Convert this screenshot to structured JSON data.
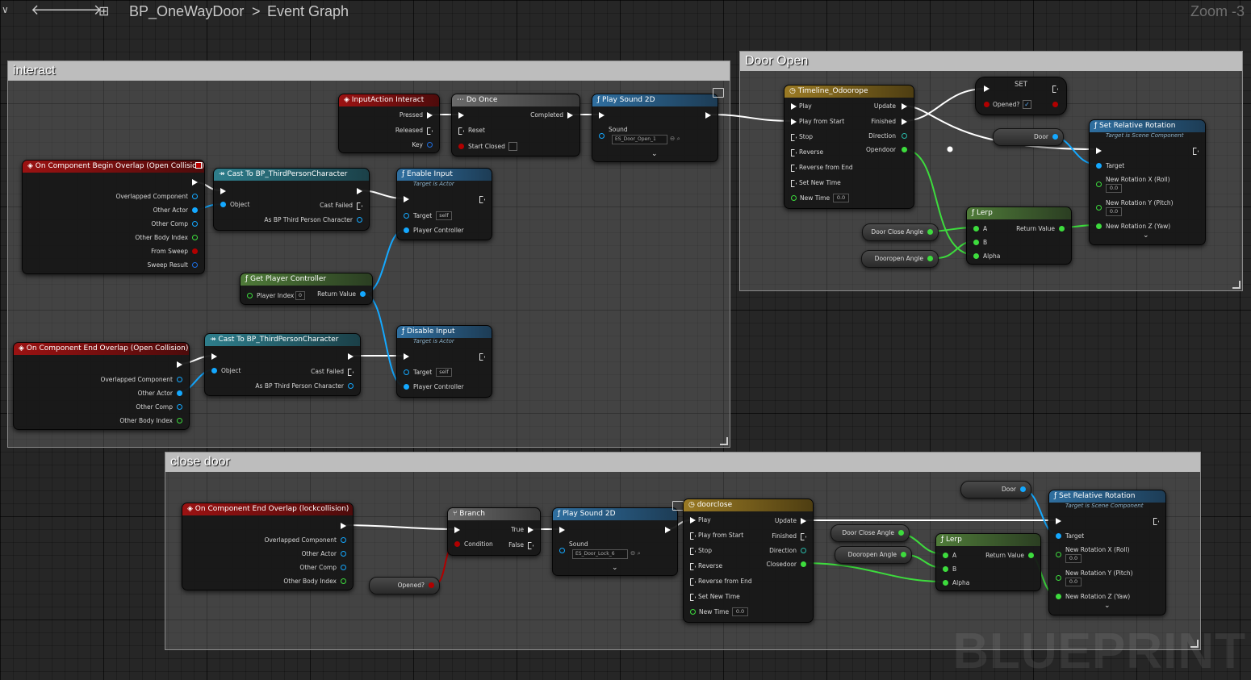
{
  "header": {
    "asset": "BP_OneWayDoor",
    "separator": ">",
    "graph": "Event Graph",
    "zoom": "Zoom -3"
  },
  "watermark": "BLUEPRINT",
  "colors": {
    "exec": "#ffffff",
    "object": "#14a8ff",
    "bool": "#b10000",
    "float": "#3ddc3d",
    "vector": "#f0c314",
    "struct": "#1d6de0"
  },
  "comments": {
    "interact": "interact",
    "door_open": "Door Open",
    "close_door": "close door"
  },
  "interact": {
    "input_action": {
      "title": "InputAction Interact",
      "pressed": "Pressed",
      "released": "Released",
      "key": "Key"
    },
    "do_once": {
      "title": "Do Once",
      "completed": "Completed",
      "reset": "Reset",
      "start_closed": "Start Closed"
    },
    "play_sound": {
      "title": "Play Sound 2D",
      "sound": "Sound",
      "asset": "ES_Door_Open_1"
    },
    "begin_overlap": {
      "title": "On Component Begin Overlap (Open Collision)",
      "pins": [
        "Overlapped Component",
        "Other Actor",
        "Other Comp",
        "Other Body Index",
        "From Sweep",
        "Sweep Result"
      ]
    },
    "cast1": {
      "title": "Cast To BP_ThirdPersonCharacter",
      "object": "Object",
      "cast_failed": "Cast Failed",
      "as": "As BP Third Person Character"
    },
    "enable_input": {
      "title": "Enable Input",
      "subtitle": "Target is Actor",
      "target": "Target",
      "self": "self",
      "pc": "Player Controller"
    },
    "get_pc": {
      "title": "Get Player Controller",
      "index": "Player Index",
      "index_val": "0",
      "ret": "Return Value"
    },
    "end_overlap": {
      "title": "On Component End Overlap (Open Collision)",
      "pins": [
        "Overlapped Component",
        "Other Actor",
        "Other Comp",
        "Other Body Index"
      ]
    },
    "cast2": {
      "title": "Cast To BP_ThirdPersonCharacter",
      "object": "Object",
      "cast_failed": "Cast Failed",
      "as": "As BP Third Person Character"
    },
    "disable_input": {
      "title": "Disable Input",
      "subtitle": "Target is Actor",
      "target": "Target",
      "self": "self",
      "pc": "Player Controller"
    }
  },
  "door_open": {
    "timeline": {
      "title": "Timeline_Odoorope",
      "inputs": [
        "Play",
        "Play from Start",
        "Stop",
        "Reverse",
        "Reverse from End",
        "Set New Time",
        "New Time"
      ],
      "new_time": "0.0",
      "outputs": [
        "Update",
        "Finished",
        "Direction",
        "Opendoor"
      ]
    },
    "set": {
      "title": "SET",
      "opened": "Opened?",
      "checked": "✓"
    },
    "door_var": "Door",
    "set_rot": {
      "title": "Set Relative Rotation",
      "subtitle": "Target is Scene Component",
      "target": "Target",
      "rx": "New Rotation X (Roll)",
      "ry": "New Rotation Y (Pitch)",
      "rz": "New Rotation Z (Yaw)",
      "vx": "0.0",
      "vy": "0.0"
    },
    "lerp": {
      "title": "Lerp",
      "a": "A",
      "b": "B",
      "alpha": "Alpha",
      "ret": "Return Value"
    },
    "close_angle": "Door Close Angle",
    "open_angle": "Dooropen Angle"
  },
  "close_door": {
    "end_overlap": {
      "title": "On Component End Overlap (lockcollision)",
      "pins": [
        "Overlapped Component",
        "Other Actor",
        "Other Comp",
        "Other Body Index"
      ]
    },
    "opened_var": "Opened?",
    "branch": {
      "title": "Branch",
      "condition": "Condition",
      "true": "True",
      "false": "False"
    },
    "play_sound": {
      "title": "Play Sound 2D",
      "sound": "Sound",
      "asset": "ES_Door_Lock_6"
    },
    "timeline": {
      "title": "doorclose",
      "inputs": [
        "Play",
        "Play from Start",
        "Stop",
        "Reverse",
        "Reverse from End",
        "Set New Time",
        "New Time"
      ],
      "new_time": "0.0",
      "outputs": [
        "Update",
        "Finished",
        "Direction",
        "Closedoor"
      ]
    },
    "close_angle": "Door Close Angle",
    "open_angle": "Dooropen Angle",
    "lerp": {
      "title": "Lerp",
      "a": "A",
      "b": "B",
      "alpha": "Alpha",
      "ret": "Return Value"
    },
    "door_var": "Door",
    "set_rot": {
      "title": "Set Relative Rotation",
      "subtitle": "Target is Scene Component",
      "target": "Target",
      "rx": "New Rotation X (Roll)",
      "ry": "New Rotation Y (Pitch)",
      "rz": "New Rotation Z (Yaw)",
      "vx": "0.0",
      "vy": "0.0"
    }
  }
}
